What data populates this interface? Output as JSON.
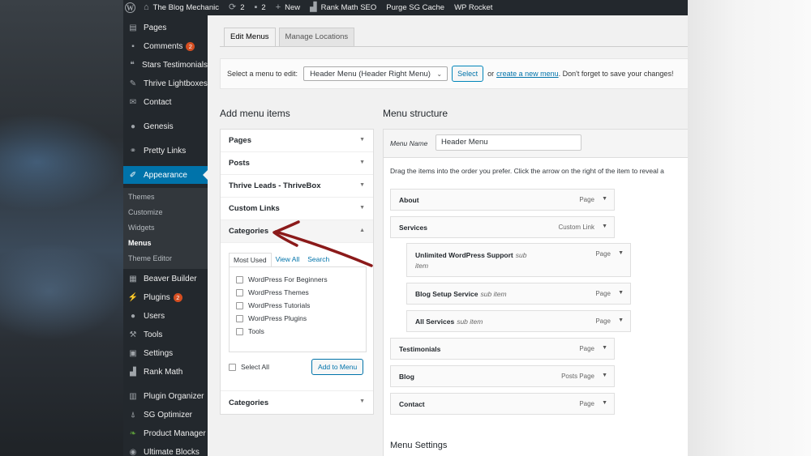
{
  "adminbar": {
    "site_name": "The Blog Mechanic",
    "updates_count": "2",
    "comments_count": "2",
    "new_label": "New",
    "rankmath_label": "Rank Math SEO",
    "purge_label": "Purge SG Cache",
    "rocket_label": "WP Rocket"
  },
  "sidebar": {
    "items": [
      {
        "label": "Pages",
        "icon": "pages-icon"
      },
      {
        "label": "Comments",
        "icon": "comments-icon",
        "badge": "2"
      },
      {
        "label": "Stars Testimonials",
        "icon": "quote-icon"
      },
      {
        "label": "Thrive Lightboxes",
        "icon": "pin-icon"
      },
      {
        "label": "Contact",
        "icon": "mail-icon"
      },
      {
        "label": "Genesis",
        "icon": "genesis-icon"
      },
      {
        "label": "Pretty Links",
        "icon": "link-icon"
      },
      {
        "label": "Appearance",
        "icon": "brush-icon"
      },
      {
        "label": "Beaver Builder",
        "icon": "grid-icon"
      },
      {
        "label": "Plugins",
        "icon": "plug-icon",
        "badge": "2"
      },
      {
        "label": "Users",
        "icon": "user-icon"
      },
      {
        "label": "Tools",
        "icon": "wrench-icon"
      },
      {
        "label": "Settings",
        "icon": "settings-icon"
      },
      {
        "label": "Rank Math",
        "icon": "chart-icon"
      },
      {
        "label": "Plugin Organizer",
        "icon": "organizer-icon"
      },
      {
        "label": "SG Optimizer",
        "icon": "sg-icon"
      },
      {
        "label": "Product Manager",
        "icon": "leaf-icon"
      },
      {
        "label": "Ultimate Blocks",
        "icon": "blocks-icon"
      }
    ],
    "submenu": [
      "Themes",
      "Customize",
      "Widgets",
      "Menus",
      "Theme Editor"
    ]
  },
  "tabs": {
    "edit_menus": "Edit Menus",
    "manage_locations": "Manage Locations"
  },
  "manage": {
    "select_label": "Select a menu to edit:",
    "selected_menu": "Header Menu (Header Right Menu)",
    "select_button": "Select",
    "or_text": "or",
    "create_link": "create a new menu",
    "reminder": ". Don't forget to save your changes!"
  },
  "add_items": {
    "heading": "Add menu items",
    "sections": [
      "Pages",
      "Posts",
      "Thrive Leads - ThriveBox",
      "Custom Links",
      "Categories"
    ],
    "subtabs": [
      "Most Used",
      "View All",
      "Search"
    ],
    "categories": [
      "WordPress For Beginners",
      "WordPress Themes",
      "WordPress Tutorials",
      "WordPress Plugins",
      "Tools"
    ],
    "select_all": "Select All",
    "add_button": "Add to Menu",
    "bottom_section": "Categories"
  },
  "structure": {
    "heading": "Menu structure",
    "menu_name_label": "Menu Name",
    "menu_name_value": "Header Menu",
    "instructions": "Drag the items into the order you prefer. Click the arrow on the right of the item to reveal a",
    "items": [
      {
        "title": "About",
        "type": "Page"
      },
      {
        "title": "Services",
        "type": "Custom Link"
      },
      {
        "title": "Unlimited WordPress Support",
        "sub": "sub",
        "sub2": "item",
        "type": "Page"
      },
      {
        "title": "Blog Setup Service",
        "sub": "sub item",
        "type": "Page"
      },
      {
        "title": "All Services",
        "sub": "sub item",
        "type": "Page"
      },
      {
        "title": "Testimonials",
        "type": "Page"
      },
      {
        "title": "Blog",
        "type": "Posts Page"
      },
      {
        "title": "Contact",
        "type": "Page"
      }
    ],
    "settings_heading": "Menu Settings"
  },
  "colors": {
    "admin_dark": "#23282d",
    "accent_blue": "#0073aa",
    "badge_orange": "#d54e21",
    "annotation_arrow": "#8b1a1a"
  }
}
